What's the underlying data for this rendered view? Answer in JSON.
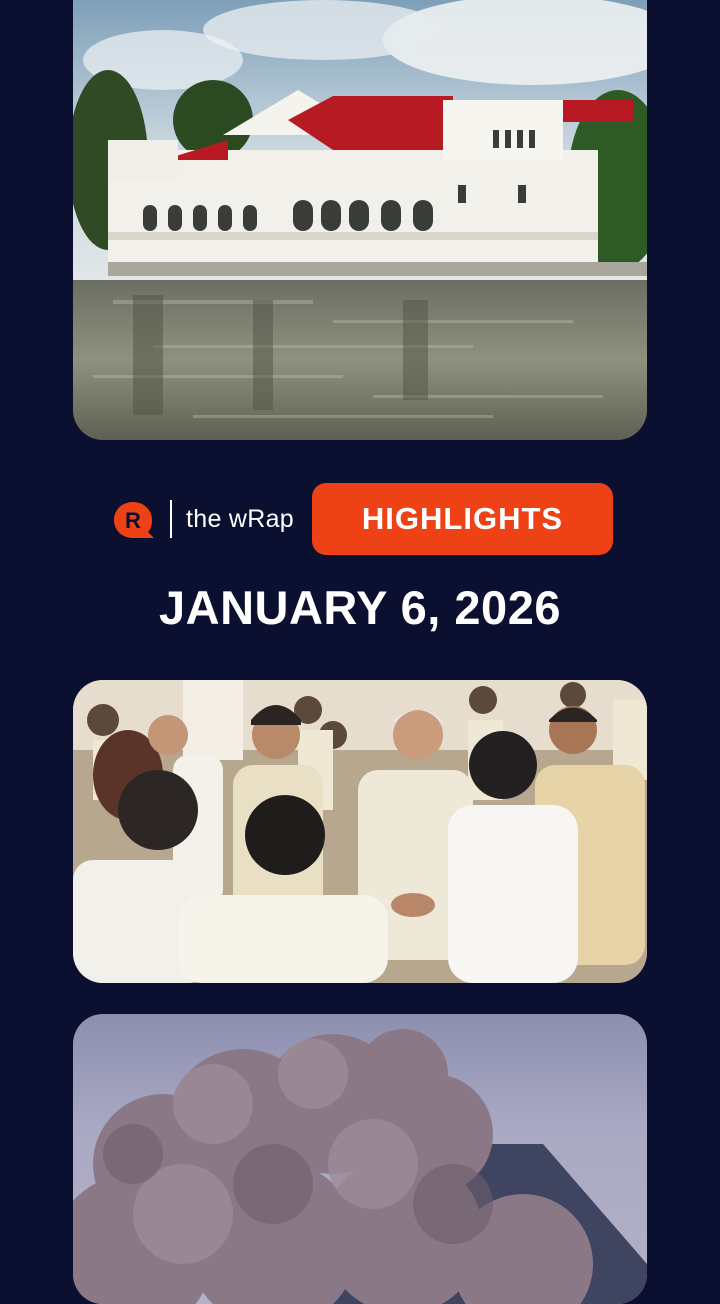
{
  "header": {
    "show_name": "the wRap",
    "badge_label": "HIGHLIGHTS",
    "date": "JANUARY 6, 2026"
  },
  "brand": {
    "logo_icon": "rappler-logo-icon",
    "accent_color": "#ee4216",
    "background_color": "#0c1030"
  },
  "stories": [
    {
      "image": "palace-by-river-photo"
    },
    {
      "image": "officials-greeting-photo"
    },
    {
      "image": "volcanic-ash-plume-photo"
    }
  ]
}
